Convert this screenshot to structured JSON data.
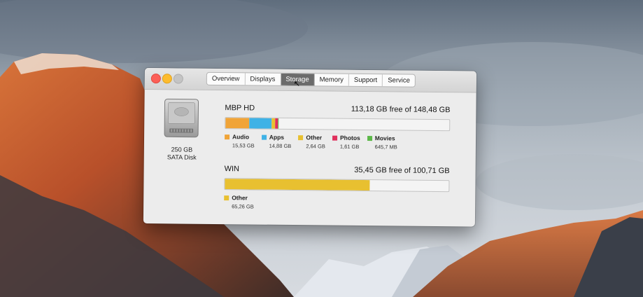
{
  "window": {
    "tabs": [
      {
        "label": "Overview",
        "active": false
      },
      {
        "label": "Displays",
        "active": false
      },
      {
        "label": "Storage",
        "active": true
      },
      {
        "label": "Memory",
        "active": false
      },
      {
        "label": "Support",
        "active": false
      },
      {
        "label": "Service",
        "active": false
      }
    ]
  },
  "disk": {
    "icon": "hard-drive-icon",
    "capacity": "250 GB",
    "type": "SATA Disk"
  },
  "volumes": [
    {
      "name": "MBP HD",
      "free_text": "113,18 GB free of 148,48 GB",
      "segments": [
        {
          "name": "Audio",
          "size": "15,53 GB",
          "fraction": 0.105,
          "color": "#f0a438"
        },
        {
          "name": "Apps",
          "size": "14,88 GB",
          "fraction": 0.1,
          "color": "#3fb2e6"
        },
        {
          "name": "Other",
          "size": "2,64 GB",
          "fraction": 0.018,
          "color": "#e8c030"
        },
        {
          "name": "Photos",
          "size": "1,61 GB",
          "fraction": 0.011,
          "color": "#e0305c"
        },
        {
          "name": "Movies",
          "size": "645,7 MB",
          "fraction": 0.004,
          "color": "#5cb848"
        }
      ]
    },
    {
      "name": "WIN",
      "free_text": "35,45 GB free of 100,71 GB",
      "segments": [
        {
          "name": "Other",
          "size": "65,26 GB",
          "fraction": 0.648,
          "color": "#e8c030"
        }
      ]
    }
  ],
  "colors": {
    "window_bg": "#ececec",
    "active_tab": "#6b6b6b",
    "close": "#fc5f57",
    "minimize": "#fdbc2e",
    "zoom_disabled": "#c4c4c4"
  }
}
